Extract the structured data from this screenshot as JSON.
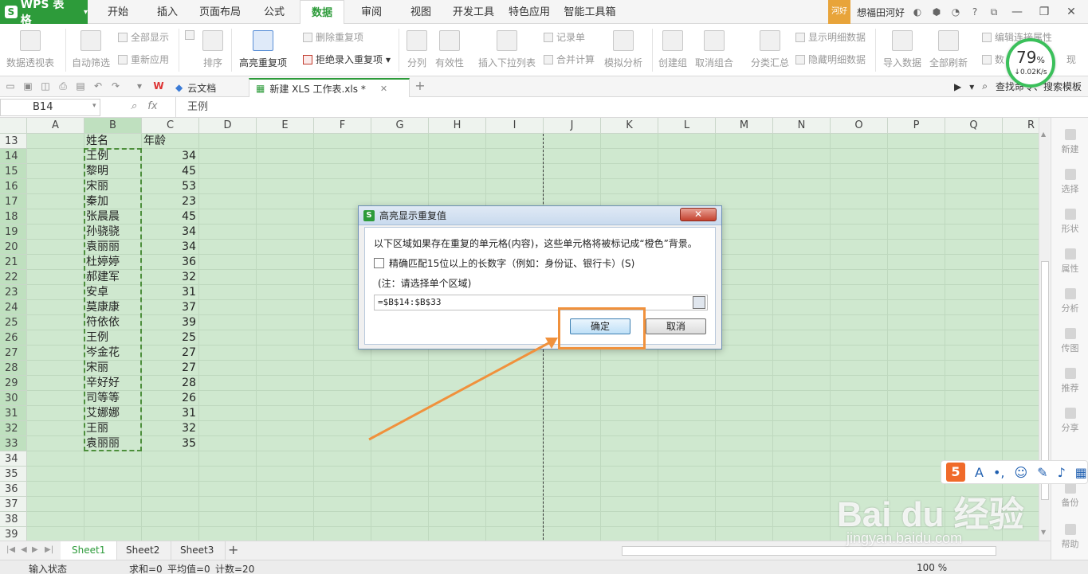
{
  "app": {
    "logo_text": "WPS 表格"
  },
  "menu": {
    "tabs": [
      "开始",
      "插入",
      "页面布局",
      "公式",
      "数据",
      "审阅",
      "视图",
      "开发工具",
      "特色应用",
      "智能工具箱"
    ],
    "active": "数据"
  },
  "user": {
    "badge": "河好",
    "name": "想福田河好"
  },
  "ribbon": {
    "pivot": "数据透视表",
    "autofilter": "自动筛选",
    "show_all": "全部显示",
    "reapply": "重新应用",
    "sort": "排序",
    "highlight_dup": "高亮重复项",
    "remove_dup": "删除重复项",
    "reject_dup": "拒绝录入重复项",
    "split": "分列",
    "validity": "有效性",
    "insert_dropdown": "插入下拉列表",
    "records": "记录单",
    "merge_calc": "合并计算",
    "simulate": "模拟分析",
    "create_group": "创建组",
    "ungroup": "取消组合",
    "subtotal": "分类汇总",
    "show_detail": "显示明细数据",
    "hide_detail": "隐藏明细数据",
    "import": "导入数据",
    "refresh_all": "全部刷新",
    "edit_links": "编辑连接属性",
    "data_more": "数",
    "present": "现"
  },
  "meter": {
    "percent": "79",
    "rate": "0.02K/s"
  },
  "tabs": {
    "doc1": "云文档",
    "doc2": "新建 XLS 工作表.xls *",
    "search": "查找命令、搜索模板"
  },
  "formula": {
    "cell_ref": "B14",
    "fx": "fx",
    "value": "王例"
  },
  "columns": [
    "A",
    "B",
    "C",
    "D",
    "E",
    "F",
    "G",
    "H",
    "I",
    "J",
    "K",
    "L",
    "M",
    "N",
    "O",
    "P",
    "Q",
    "R"
  ],
  "rows": [
    13,
    14,
    15,
    16,
    17,
    18,
    19,
    20,
    21,
    22,
    23,
    24,
    25,
    26,
    27,
    28,
    29,
    30,
    31,
    32,
    33,
    34,
    35,
    36,
    37,
    38,
    39
  ],
  "table": {
    "header_name": "姓名",
    "header_age": "年龄",
    "records": [
      {
        "name": "王例",
        "age": "34"
      },
      {
        "name": "黎明",
        "age": "45"
      },
      {
        "name": "宋丽",
        "age": "53"
      },
      {
        "name": "秦加",
        "age": "23"
      },
      {
        "name": "张晨晨",
        "age": "45"
      },
      {
        "name": "孙骁骁",
        "age": "34"
      },
      {
        "name": "袁丽丽",
        "age": "34"
      },
      {
        "name": "杜婷婷",
        "age": "36"
      },
      {
        "name": "郝建军",
        "age": "32"
      },
      {
        "name": "安卓",
        "age": "31"
      },
      {
        "name": "莫康康",
        "age": "37"
      },
      {
        "name": "符依依",
        "age": "39"
      },
      {
        "name": "王例",
        "age": "25"
      },
      {
        "name": "岑金花",
        "age": "27"
      },
      {
        "name": "宋丽",
        "age": "27"
      },
      {
        "name": "辛好好",
        "age": "28"
      },
      {
        "name": "司等等",
        "age": "26"
      },
      {
        "name": "艾娜娜",
        "age": "31"
      },
      {
        "name": "王丽",
        "age": "32"
      },
      {
        "name": "袁丽丽",
        "age": "35"
      }
    ]
  },
  "dialog": {
    "title": "高亮显示重复值",
    "close": "✕",
    "description": "以下区域如果存在重复的单元格(内容)，这些单元格将被标记成“橙色”背景。",
    "checkbox_label": "精确匹配15位以上的长数字（例如：身份证、银行卡）(S)",
    "note": "(注：请选择单个区域)",
    "range_value": "=$B$14:$B$33",
    "ok": "确定",
    "cancel": "取消"
  },
  "sidebar": [
    "新建",
    "选择",
    "形状",
    "属性",
    "分析",
    "传图",
    "推荐",
    "分享",
    "备份",
    "帮助"
  ],
  "sheets": [
    "Sheet1",
    "Sheet2",
    "Sheet3"
  ],
  "status": {
    "input_state": "输入状态",
    "sum": "求和=0",
    "avg": "平均值=0",
    "count": "计数=20",
    "zoom": "100 %"
  },
  "watermark": {
    "text": "Bai du 经验",
    "url": "jingyan.baidu.com"
  },
  "colors": {
    "accent": "#2d9b3a",
    "highlight": "#f0913c",
    "grid": "#cfe8cf"
  }
}
